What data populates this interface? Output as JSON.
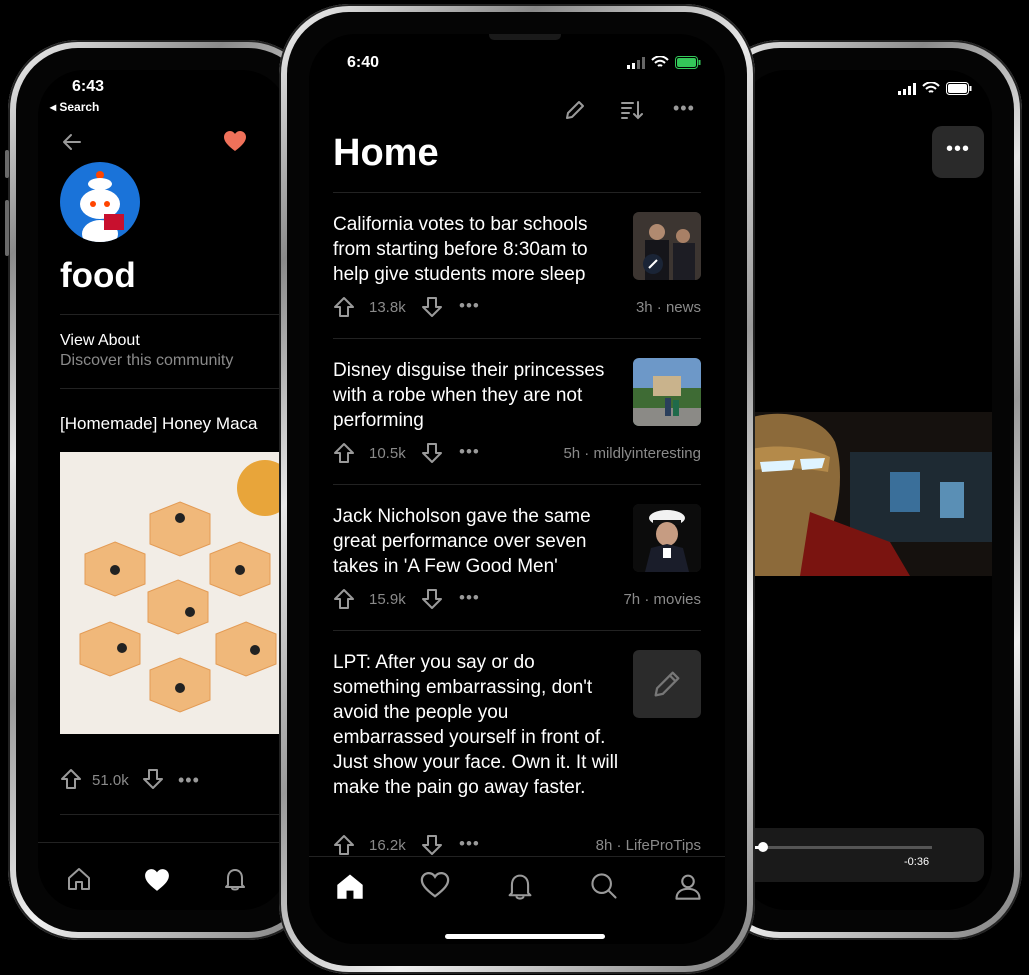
{
  "left_screen": {
    "time": "6:43",
    "back_label": "◂ Search",
    "community_title": "food",
    "view_about": "View About",
    "view_about_sub": "Discover this community",
    "post_title": "[Homemade] Honey Maca",
    "post_score": "51.0k"
  },
  "center_screen": {
    "time": "6:40",
    "page_title": "Home",
    "posts": [
      {
        "title": "California votes to bar schools from starting before 8:30am to help give students more sleep",
        "score": "13.8k",
        "meta": "3h · news",
        "thumb": "photo-press"
      },
      {
        "title": "Disney disguise their princesses with a robe when they are not performing",
        "score": "10.5k",
        "meta": "5h · mildlyinteresting",
        "thumb": "photo-park"
      },
      {
        "title": "Jack Nicholson gave the same great performance over seven takes in 'A Few Good Men'",
        "score": "15.9k",
        "meta": "7h · movies",
        "thumb": "photo-marine"
      },
      {
        "title": "LPT: After you say or do something embarrassing, don't avoid the people you embarrassed yourself in front of. Just show your face. Own it. It will make the pain go away faster.",
        "score": "16.2k",
        "meta": "8h · LifeProTips",
        "thumb": "pencil-icon"
      }
    ],
    "tabs": [
      "home-icon",
      "heart-icon",
      "bell-icon",
      "search-icon",
      "profile-icon"
    ]
  },
  "right_screen": {
    "time_remaining": "-0:36"
  },
  "colors": {
    "accent_heart": "#f0715a",
    "avatar_blue": "#1a73d9",
    "muted_text": "#8a8a8a",
    "battery_green": "#34c759"
  }
}
